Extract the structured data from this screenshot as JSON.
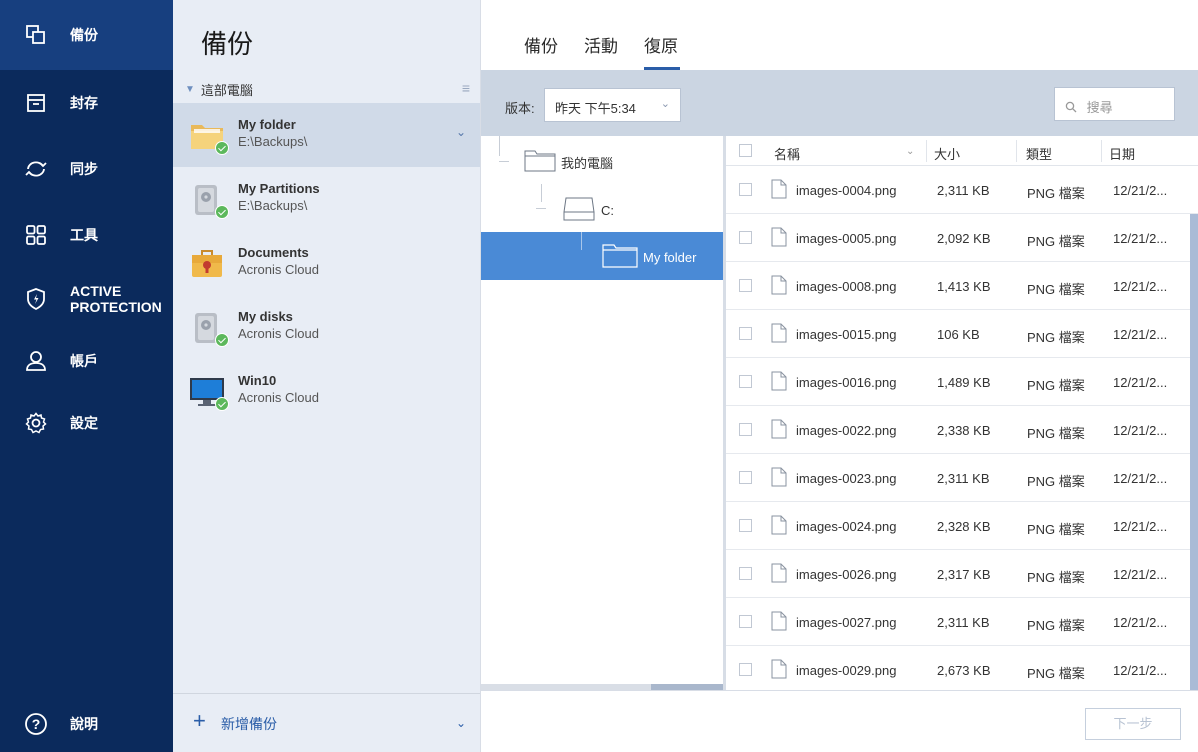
{
  "nav": {
    "items": [
      {
        "label": "備份",
        "icon": "backup-icon",
        "active": true
      },
      {
        "label": "封存",
        "icon": "archive-icon"
      },
      {
        "label": "同步",
        "icon": "sync-icon"
      },
      {
        "label": "工具",
        "icon": "tools-icon"
      },
      {
        "label": "ACTIVE",
        "label2": "PROTECTION",
        "icon": "shield-icon"
      },
      {
        "label": "帳戶",
        "icon": "account-icon"
      },
      {
        "label": "設定",
        "icon": "gear-icon"
      }
    ],
    "help": {
      "label": "說明",
      "icon": "help-icon"
    }
  },
  "list": {
    "title": "備份",
    "group": "這部電腦",
    "items": [
      {
        "name": "My folder",
        "location": "E:\\Backups\\",
        "icon": "folder-icon"
      },
      {
        "name": "My Partitions",
        "location": "E:\\Backups\\",
        "icon": "disk-icon"
      },
      {
        "name": "Documents",
        "location": "Acronis Cloud",
        "icon": "briefcase-icon"
      },
      {
        "name": "My disks",
        "location": "Acronis Cloud",
        "icon": "disk-icon"
      },
      {
        "name": "Win10",
        "location": "Acronis Cloud",
        "icon": "monitor-icon"
      }
    ],
    "add_label": "新增備份"
  },
  "tabs": [
    "備份",
    "活動",
    "復原"
  ],
  "toolbar": {
    "version_label": "版本:",
    "version_value": "昨天 下午5:34",
    "search_placeholder": "搜尋"
  },
  "tree": {
    "root": "我的電腦",
    "drive": "C:",
    "folder": "My folder"
  },
  "grid": {
    "headers": {
      "name": "名稱",
      "size": "大小",
      "type": "類型",
      "date": "日期"
    },
    "rows": [
      {
        "name": "images-0004.png",
        "size": "2,311 KB",
        "type": "PNG 檔案",
        "date": "12/21/2..."
      },
      {
        "name": "images-0005.png",
        "size": "2,092 KB",
        "type": "PNG 檔案",
        "date": "12/21/2..."
      },
      {
        "name": "images-0008.png",
        "size": "1,413 KB",
        "type": "PNG 檔案",
        "date": "12/21/2..."
      },
      {
        "name": "images-0015.png",
        "size": "106 KB",
        "type": "PNG 檔案",
        "date": "12/21/2..."
      },
      {
        "name": "images-0016.png",
        "size": "1,489 KB",
        "type": "PNG 檔案",
        "date": "12/21/2..."
      },
      {
        "name": "images-0022.png",
        "size": "2,338 KB",
        "type": "PNG 檔案",
        "date": "12/21/2..."
      },
      {
        "name": "images-0023.png",
        "size": "2,311 KB",
        "type": "PNG 檔案",
        "date": "12/21/2..."
      },
      {
        "name": "images-0024.png",
        "size": "2,328 KB",
        "type": "PNG 檔案",
        "date": "12/21/2..."
      },
      {
        "name": "images-0026.png",
        "size": "2,317 KB",
        "type": "PNG 檔案",
        "date": "12/21/2..."
      },
      {
        "name": "images-0027.png",
        "size": "2,311 KB",
        "type": "PNG 檔案",
        "date": "12/21/2..."
      },
      {
        "name": "images-0029.png",
        "size": "2,673 KB",
        "type": "PNG 檔案",
        "date": "12/21/2..."
      }
    ]
  },
  "footer": {
    "next_label": "下一步"
  },
  "colors": {
    "nav_bg": "#0b2a5c",
    "nav_active": "#173f7f",
    "accent": "#2a5da8",
    "selection": "#4a8ad6",
    "check": "#5cb85c"
  }
}
